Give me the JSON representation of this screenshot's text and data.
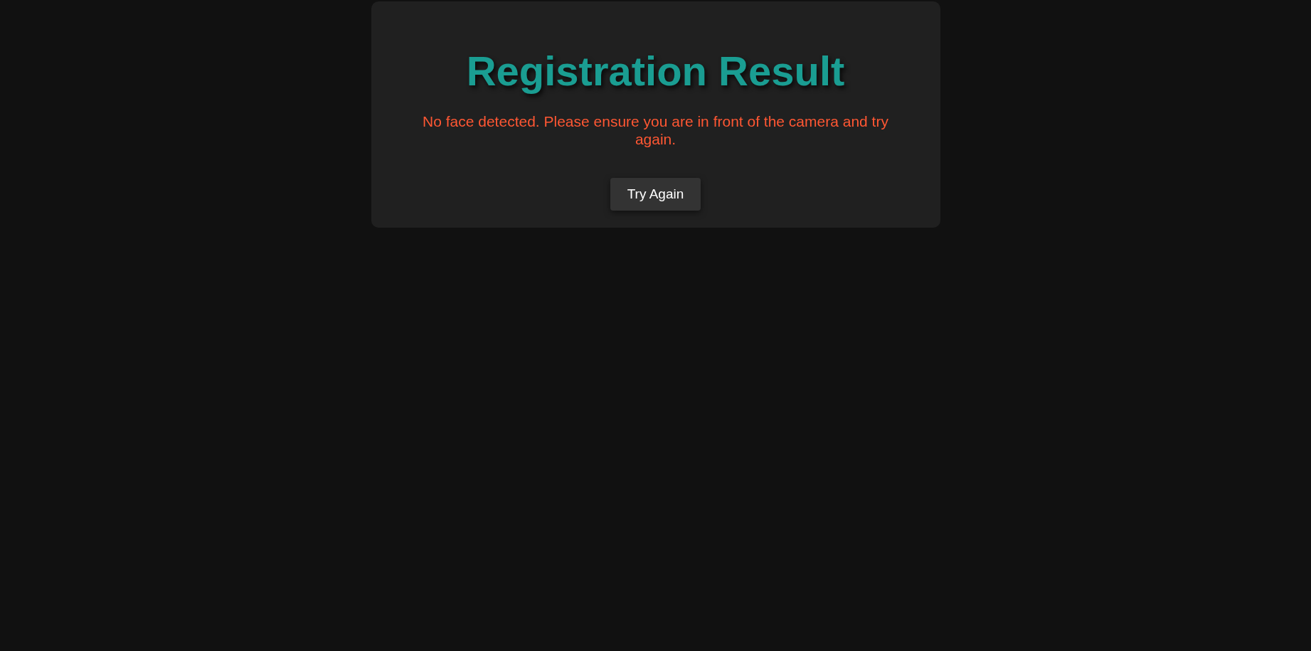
{
  "title": "Registration Result",
  "message": "No face detected. Please ensure you are in front of the camera and try again.",
  "button": {
    "label": "Try Again"
  }
}
